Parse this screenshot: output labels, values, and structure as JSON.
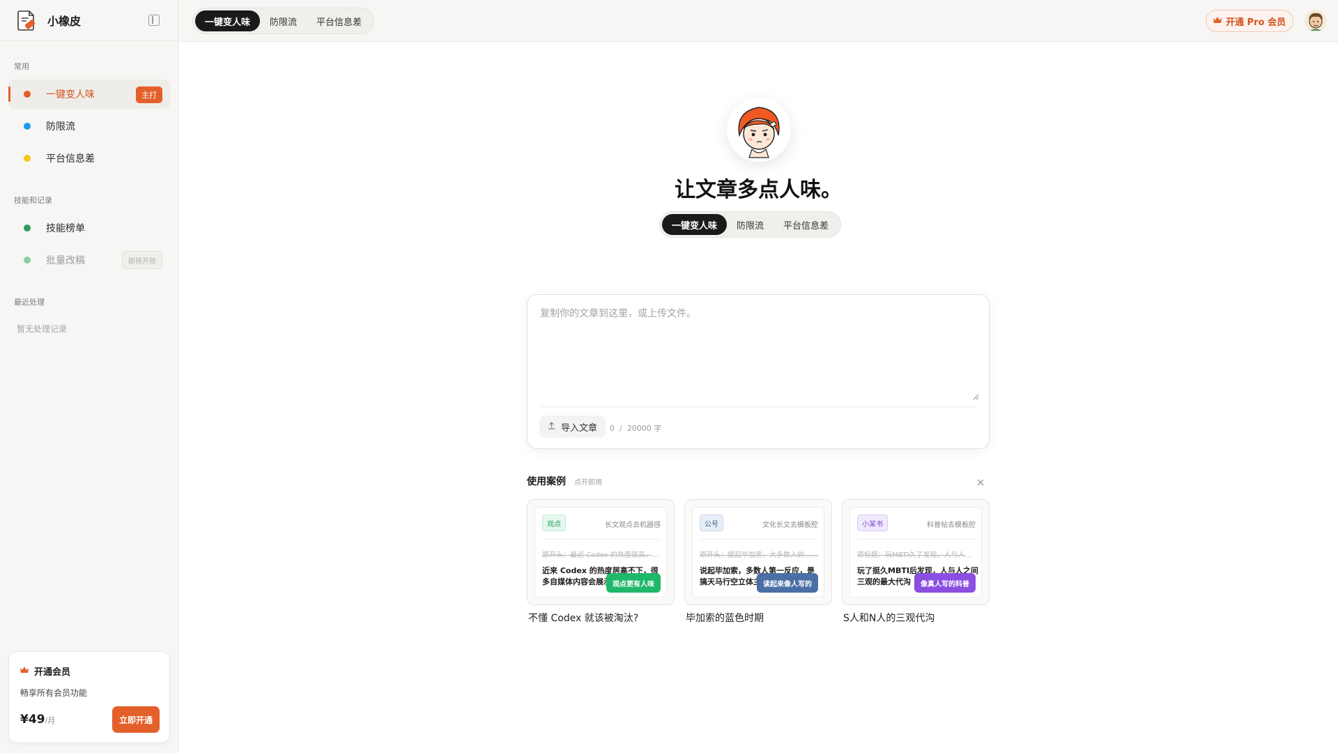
{
  "app": {
    "name": "小橡皮"
  },
  "modes": [
    "一键变人味",
    "防限流",
    "平台信息差"
  ],
  "sidebar": {
    "sections": [
      {
        "title": "常用",
        "items": [
          {
            "label": "一键变人味",
            "badge": "主打",
            "color": "#e45d27",
            "active": true
          },
          {
            "label": "防限流",
            "color": "#1d9bf0"
          },
          {
            "label": "平台信息差",
            "color": "#f5c518"
          }
        ]
      },
      {
        "title": "技能和记录",
        "items": [
          {
            "label": "技能榜单",
            "color": "#2e9d5a"
          },
          {
            "label": "批量改稿",
            "badge": "即将开放",
            "color": "#86cfa0",
            "disabled": true
          }
        ]
      },
      {
        "title": "最近处理",
        "empty": "暂无处理记录"
      }
    ],
    "vip": {
      "title": "开通会员",
      "desc": "畅享所有会员功能",
      "price": "¥49",
      "unit": "/月",
      "button": "立即开通"
    }
  },
  "topbar": {
    "pro_button": "开通 Pro 会员"
  },
  "hero": {
    "title": "让文章多点人味。"
  },
  "editor": {
    "placeholder": "复制你的文章到这里，或上传文件。",
    "import_label": "导入文章",
    "count": "0",
    "max": "20000",
    "unit": "字"
  },
  "examples": {
    "title": "使用案例",
    "subtitle": "点开即用",
    "items": [
      {
        "tag": "观点",
        "category": "长文观点去机器感",
        "original": "原开头：最近 Codex 的热度很高，……",
        "rewritten": "近来 Codex 的热度居高不下，很多自媒体内容会展示",
        "chip": "观点更有人味",
        "caption": "不懂 Codex 就该被淘汰?",
        "accent": "#1fb86a",
        "tag_bg": "#e7f7ee",
        "tag_fg": "#1fa35d"
      },
      {
        "tag": "公号",
        "category": "文化长文去模板腔",
        "original": "原开头：提起毕加索，大多数人的……",
        "rewritten": "说起毕加索，多数人第一反应，是搞天马行空立体主义",
        "chip": "读起来像人写的",
        "caption": "毕加索的蓝色时期",
        "accent": "#4a6fa5",
        "tag_bg": "#e8eef7",
        "tag_fg": "#3e5f90"
      },
      {
        "tag": "小某书",
        "category": "科普帖去模板腔",
        "original": "原标题：玩MBTI久了发现，人与人……",
        "rewritten": "玩了挺久MBTI后发现，人与人之间三观的最大代沟",
        "chip": "像真人写的科普",
        "caption": "S人和N人的三观代沟",
        "accent": "#8a4fe0",
        "tag_bg": "#f1eafc",
        "tag_fg": "#7a44d0"
      }
    ]
  }
}
